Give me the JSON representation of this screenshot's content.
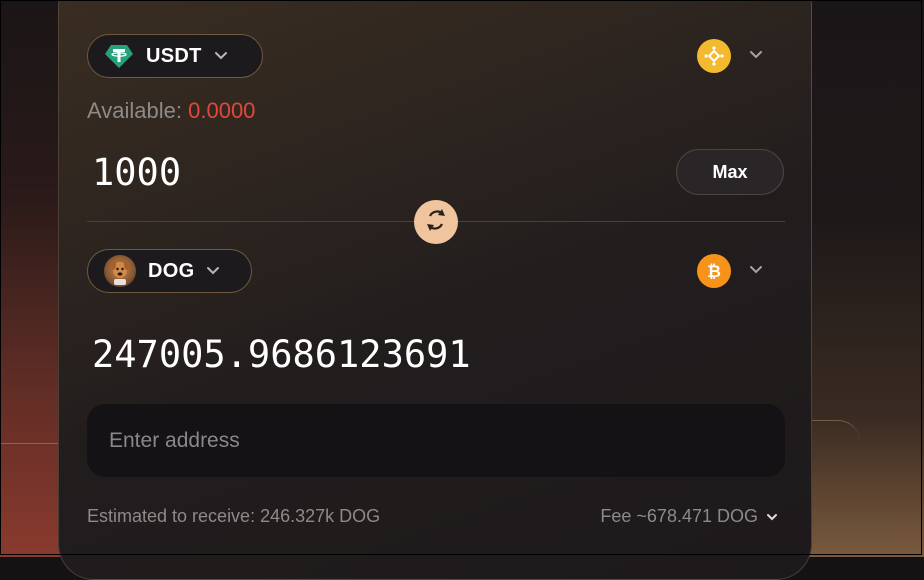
{
  "from": {
    "token": "USDT",
    "token_icon": "tether-icon",
    "chain_icon": "bnb-icon",
    "available_label": "Available:",
    "available_value": "0.0000",
    "amount": "1000",
    "max_label": "Max"
  },
  "to": {
    "token": "DOG",
    "token_icon": "dog-avatar-icon",
    "chain_icon": "bitcoin-icon",
    "amount": "247005.9686123691"
  },
  "address": {
    "placeholder": "Enter address"
  },
  "footer": {
    "estimated": "Estimated to receive: 246.327k DOG",
    "fee": "Fee ~678.471 DOG"
  },
  "colors": {
    "accent": "#f0c49c",
    "error": "#e0483b",
    "tether": "#26a17b",
    "bnb": "#f3ba2f",
    "bitcoin": "#f7931a"
  }
}
